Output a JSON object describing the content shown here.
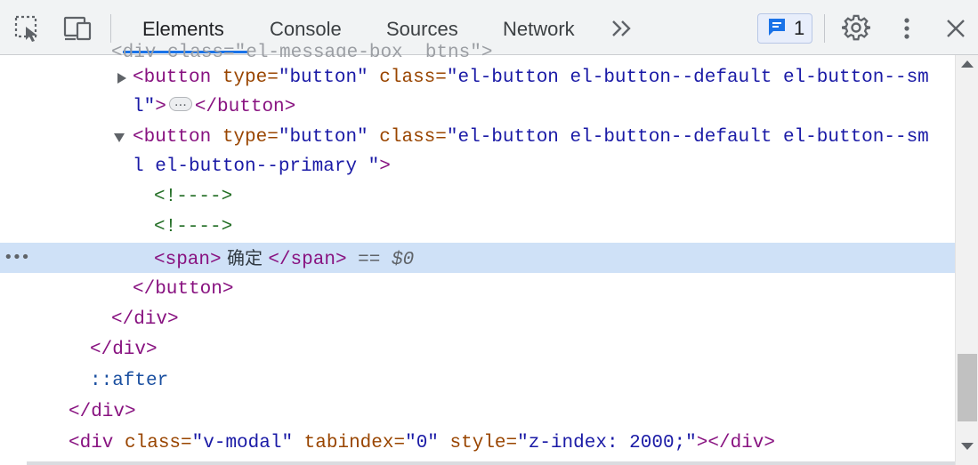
{
  "toolbar": {
    "tabs": [
      "Elements",
      "Console",
      "Sources",
      "Network"
    ],
    "more_tabs_icon": "double-chevron-right-icon",
    "issues_count": "1",
    "icons": [
      "inspect-element-icon",
      "device-toolbar-icon",
      "message-icon",
      "gear-icon",
      "kebab-menu-icon",
      "close-icon"
    ]
  },
  "ghost_line": "<div class=\"el-message-box__btns\">",
  "tree": {
    "l1": {
      "open": "<button",
      "a1": " type=",
      "v1": "\"button\"",
      "a2": " class=",
      "v2": "\"el-button el-button--default el-button--sm"
    },
    "l2": {
      "v": "l\"",
      "t1": ">",
      "t2": "</button>",
      "ellipsis": "…"
    },
    "l3": {
      "open": "<button",
      "a1": " type=",
      "v1": "\"button\"",
      "a2": " class=",
      "v2": "\"el-button el-button--default el-button--sm"
    },
    "l4": {
      "v": "l el-button--primary \"",
      "t": ">"
    },
    "l5": {
      "c": "<!---->"
    },
    "l6": {
      "c": "<!---->"
    },
    "l7": {
      "t1": "<span>",
      "text": " 确定 ",
      "t2": "</span>",
      "eq": " == $0",
      "dots": "•••"
    },
    "l8": {
      "t": "</button>"
    },
    "l9": {
      "t": "</div>"
    },
    "l10": {
      "t": "</div>"
    },
    "l11": {
      "p": "::after"
    },
    "l12": {
      "t": "</div>"
    },
    "l13": {
      "t1": "<div",
      "a1": " class=",
      "v1": "\"v-modal\"",
      "a2": " tabindex=",
      "v2": "\"0\"",
      "a3": " style=",
      "v3": "\"z-index: 2000;\"",
      "t2": "></div>"
    }
  }
}
